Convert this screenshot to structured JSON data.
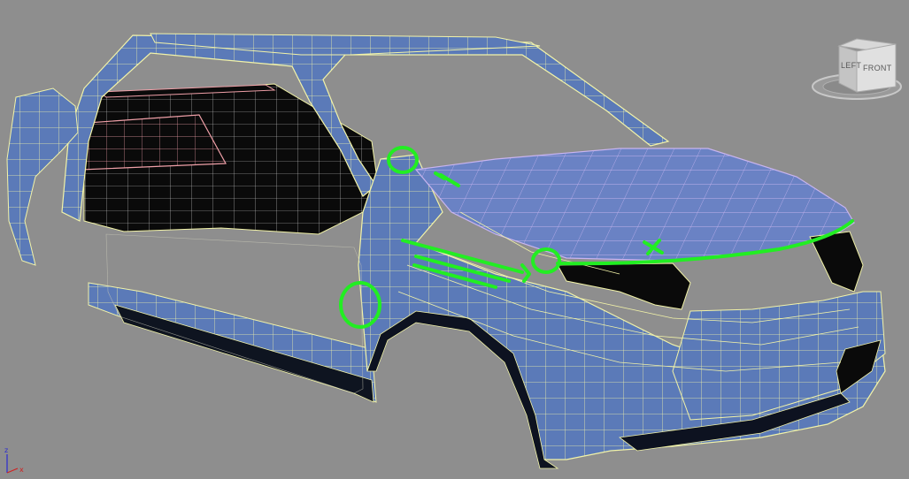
{
  "viewcube": {
    "left_label": "LEFT",
    "front_label": "FRONT"
  },
  "axis_tripod": {
    "z_label": "z",
    "x_label": "x"
  },
  "colors": {
    "viewport_bg": "#8e8e8e",
    "mesh_fill": "#5b7ab8",
    "mesh_fill_dark": "#445f96",
    "wire_yellow": "#f2f3a8",
    "wire_pink": "#f0a0a8",
    "wire_lilac": "#c8b4f0",
    "interior_black": "#0a0a0a",
    "annotation_green": "#22ee22",
    "axis_z": "#2a2ad0",
    "axis_x": "#d02020"
  }
}
